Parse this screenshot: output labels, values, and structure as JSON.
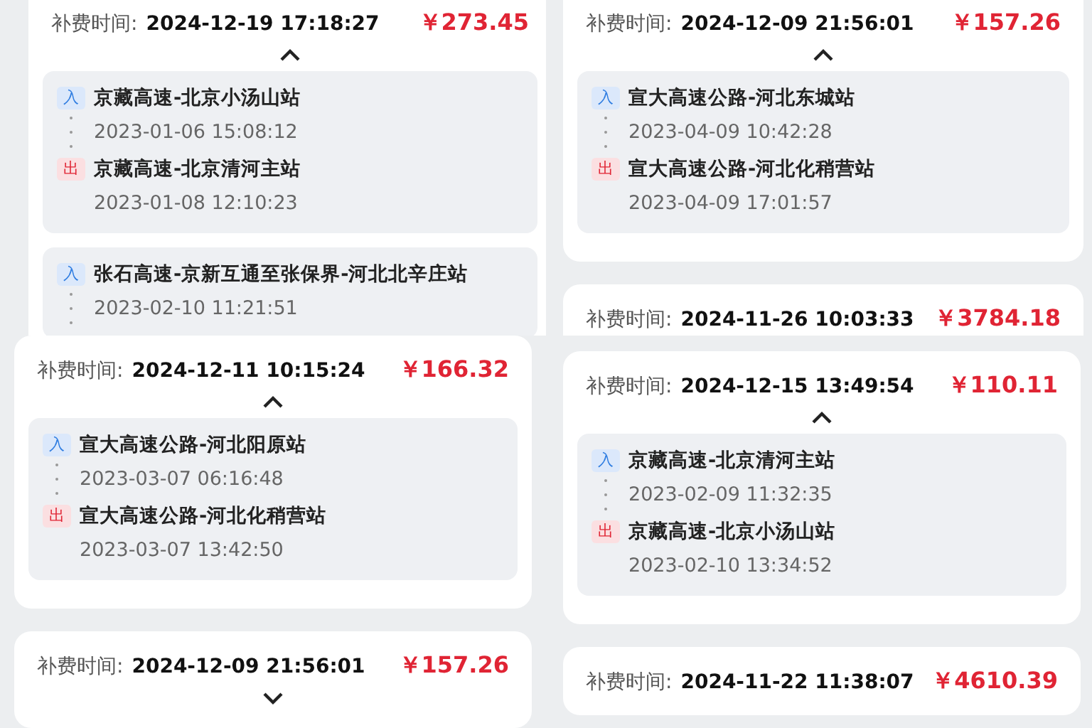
{
  "panels": [
    {
      "cards": [
        {
          "label": "补费时间:",
          "time": "2024-12-19 17:18:27",
          "amount": "￥273.45",
          "expanded": true,
          "segments": [
            [
              {
                "kind": "entry",
                "badge": "入",
                "station": "京藏高速-北京小汤山站",
                "time": "2023-01-06 15:08:12"
              },
              {
                "kind": "exit",
                "badge": "出",
                "station": "京藏高速-北京清河主站",
                "time": "2023-01-08 12:10:23"
              }
            ],
            [
              {
                "kind": "entry",
                "badge": "入",
                "station": "张石高速-京新互通至张保界-河北北辛庄站",
                "time": "2023-02-10 11:21:51"
              }
            ]
          ]
        }
      ]
    },
    {
      "cards": [
        {
          "label": "补费时间:",
          "time": "2024-12-09 21:56:01",
          "amount": "￥157.26",
          "expanded": true,
          "segments": [
            [
              {
                "kind": "entry",
                "badge": "入",
                "station": "宣大高速公路-河北东城站",
                "time": "2023-04-09 10:42:28"
              },
              {
                "kind": "exit",
                "badge": "出",
                "station": "宣大高速公路-河北化稍营站",
                "time": "2023-04-09 17:01:57"
              }
            ]
          ]
        },
        {
          "label": "补费时间:",
          "time": "2024-11-26 10:03:33",
          "amount": "￥3784.18"
        }
      ]
    },
    {
      "cards": [
        {
          "label": "补费时间:",
          "time": "2024-12-11 10:15:24",
          "amount": "￥166.32",
          "expanded": true,
          "segments": [
            [
              {
                "kind": "entry",
                "badge": "入",
                "station": "宣大高速公路-河北阳原站",
                "time": "2023-03-07 06:16:48"
              },
              {
                "kind": "exit",
                "badge": "出",
                "station": "宣大高速公路-河北化稍营站",
                "time": "2023-03-07 13:42:50"
              }
            ]
          ]
        },
        {
          "label": "补费时间:",
          "time": "2024-12-09 21:56:01",
          "amount": "￥157.26",
          "expanded": false
        }
      ]
    },
    {
      "cards": [
        {
          "label": "补费时间:",
          "time": "2024-12-15 13:49:54",
          "amount": "￥110.11",
          "expanded": true,
          "segments": [
            [
              {
                "kind": "entry",
                "badge": "入",
                "station": "京藏高速-北京清河主站",
                "time": "2023-02-09 11:32:35"
              },
              {
                "kind": "exit",
                "badge": "出",
                "station": "京藏高速-北京小汤山站",
                "time": "2023-02-10 13:34:52"
              }
            ]
          ]
        },
        {
          "label": "补费时间:",
          "time": "2024-11-22 11:38:07",
          "amount": "￥4610.39"
        }
      ]
    }
  ]
}
